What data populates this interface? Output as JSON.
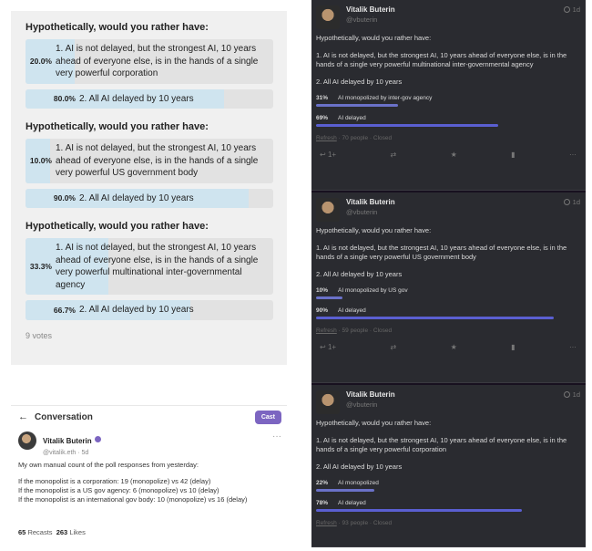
{
  "polls": [
    {
      "question": "Hypothetically, would you rather have:",
      "options": [
        {
          "pct": "20.0%",
          "fraction": 0.2,
          "text": "1. AI is not delayed, but the strongest AI, 10 years ahead of everyone else, is in the hands of a single very powerful corporation"
        },
        {
          "pct": "80.0%",
          "fraction": 0.8,
          "text": "2. All AI delayed by 10 years"
        }
      ]
    },
    {
      "question": "Hypothetically, would you rather have:",
      "options": [
        {
          "pct": "10.0%",
          "fraction": 0.1,
          "text": "1. AI is not delayed, but the strongest AI, 10 years ahead of everyone else, is in the hands of a single very powerful US government body"
        },
        {
          "pct": "90.0%",
          "fraction": 0.9,
          "text": "2. All AI delayed by 10 years"
        }
      ]
    },
    {
      "question": "Hypothetically, would you rather have:",
      "options": [
        {
          "pct": "33.3%",
          "fraction": 0.333,
          "text": "1. AI is not delayed, but the strongest AI, 10 years ahead of everyone else, is in the hands of a single very powerful multinational inter-governmental agency"
        },
        {
          "pct": "66.7%",
          "fraction": 0.667,
          "text": "2. All AI delayed by 10 years"
        }
      ]
    }
  ],
  "votes": "9 votes",
  "conversation": {
    "back_label": "←",
    "title": "Conversation",
    "cast_button": "Cast",
    "user_name": "Vitalik Buterin",
    "handle": "@vitalik.eth · 5d",
    "more": "···",
    "intro": "My own manual count of the poll responses from yesterday:",
    "lines": [
      "If the monopolist is a corporation: 19 (monopolize) vs 42 (delay)",
      "If the monopolist is a US gov agency: 6 (monopolize) vs 10 (delay)",
      "If the monopolist is an international gov body: 10 (monopolize) vs 16 (delay)"
    ],
    "recasts_count": "65",
    "recasts_label": "Recasts",
    "likes_count": "263",
    "likes_label": "Likes"
  },
  "casts": [
    {
      "name": "Vitalik Buterin",
      "handle": "@vbuterin",
      "time": "1d",
      "question": "Hypothetically, would you rather have:",
      "option1": "1. AI is not delayed, but the strongest AI, 10 years ahead of everyone else, is in the hands of a single very powerful multinational inter-governmental agency",
      "option2": "2. All AI delayed by 10 years",
      "results": [
        {
          "pct": "31%",
          "fraction": 0.31,
          "label": "AI monopolized by inter-gov agency"
        },
        {
          "pct": "69%",
          "fraction": 0.69,
          "label": "AI delayed"
        }
      ],
      "refresh": "Refresh",
      "meta": " · 70 people · Closed",
      "reply_count": "1+"
    },
    {
      "name": "Vitalik Buterin",
      "handle": "@vbuterin",
      "time": "1d",
      "question": "Hypothetically, would you rather have:",
      "option1": "1. AI is not delayed, but the strongest AI, 10 years ahead of everyone else, is in the hands of a single very powerful US government body",
      "option2": "2. All AI delayed by 10 years",
      "results": [
        {
          "pct": "10%",
          "fraction": 0.1,
          "label": "AI monopolized by US gov"
        },
        {
          "pct": "90%",
          "fraction": 0.9,
          "label": "AI delayed"
        }
      ],
      "refresh": "Refresh",
      "meta": " · 59 people · Closed",
      "reply_count": "1+"
    },
    {
      "name": "Vitalik Buterin",
      "handle": "@vbuterin",
      "time": "1d",
      "question": "Hypothetically, would you rather have:",
      "option1": "1. AI is not delayed, but the strongest AI, 10 years ahead of everyone else, is in the hands of a single very powerful corporation",
      "option2": "2. All AI delayed by 10 years",
      "results": [
        {
          "pct": "22%",
          "fraction": 0.22,
          "label": "AI monopolized"
        },
        {
          "pct": "78%",
          "fraction": 0.78,
          "label": "AI delayed"
        }
      ],
      "refresh": "Refresh",
      "meta": " · 93 people · Closed",
      "reply_count": ""
    }
  ],
  "colors": {
    "poll_fill": "#cfe4ef",
    "poll_bg": "#e2e2e2",
    "dark_card": "#2a2b30",
    "dark_bar": "#5a5fd1",
    "cast_button": "#7c65c1"
  },
  "icons": {
    "reply": "reply-icon",
    "recast": "recast-icon",
    "like": "star-icon",
    "bookmark": "bookmark-icon",
    "more": "more-icon"
  }
}
